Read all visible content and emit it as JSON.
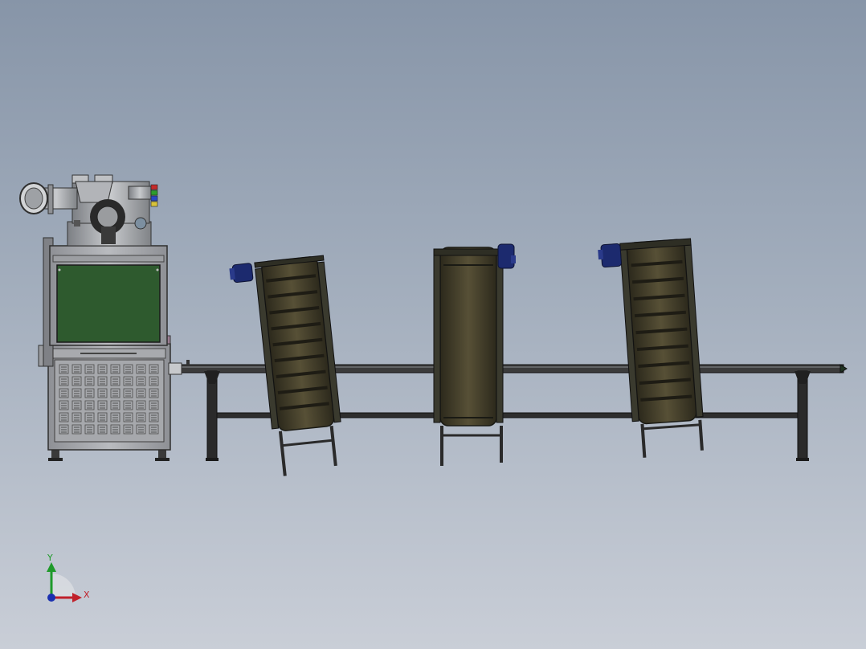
{
  "view": {
    "background_top": "#8795a8",
    "background_bottom": "#c9ced7"
  },
  "triad": {
    "x_label": "X",
    "y_label": "Y",
    "x_color": "#c0202a",
    "y_color": "#1f9a2a",
    "z_color": "#1a2fb0"
  },
  "model": {
    "machine_screen_color": "#2e5a2e",
    "conveyor_color": "#3f3a28",
    "frame_color": "#2b2b2b",
    "motor_color": "#1c2a6e",
    "stack_light_colors": [
      "#c42b2b",
      "#2e9c2e",
      "#2a47c4",
      "#d8c33a"
    ]
  }
}
